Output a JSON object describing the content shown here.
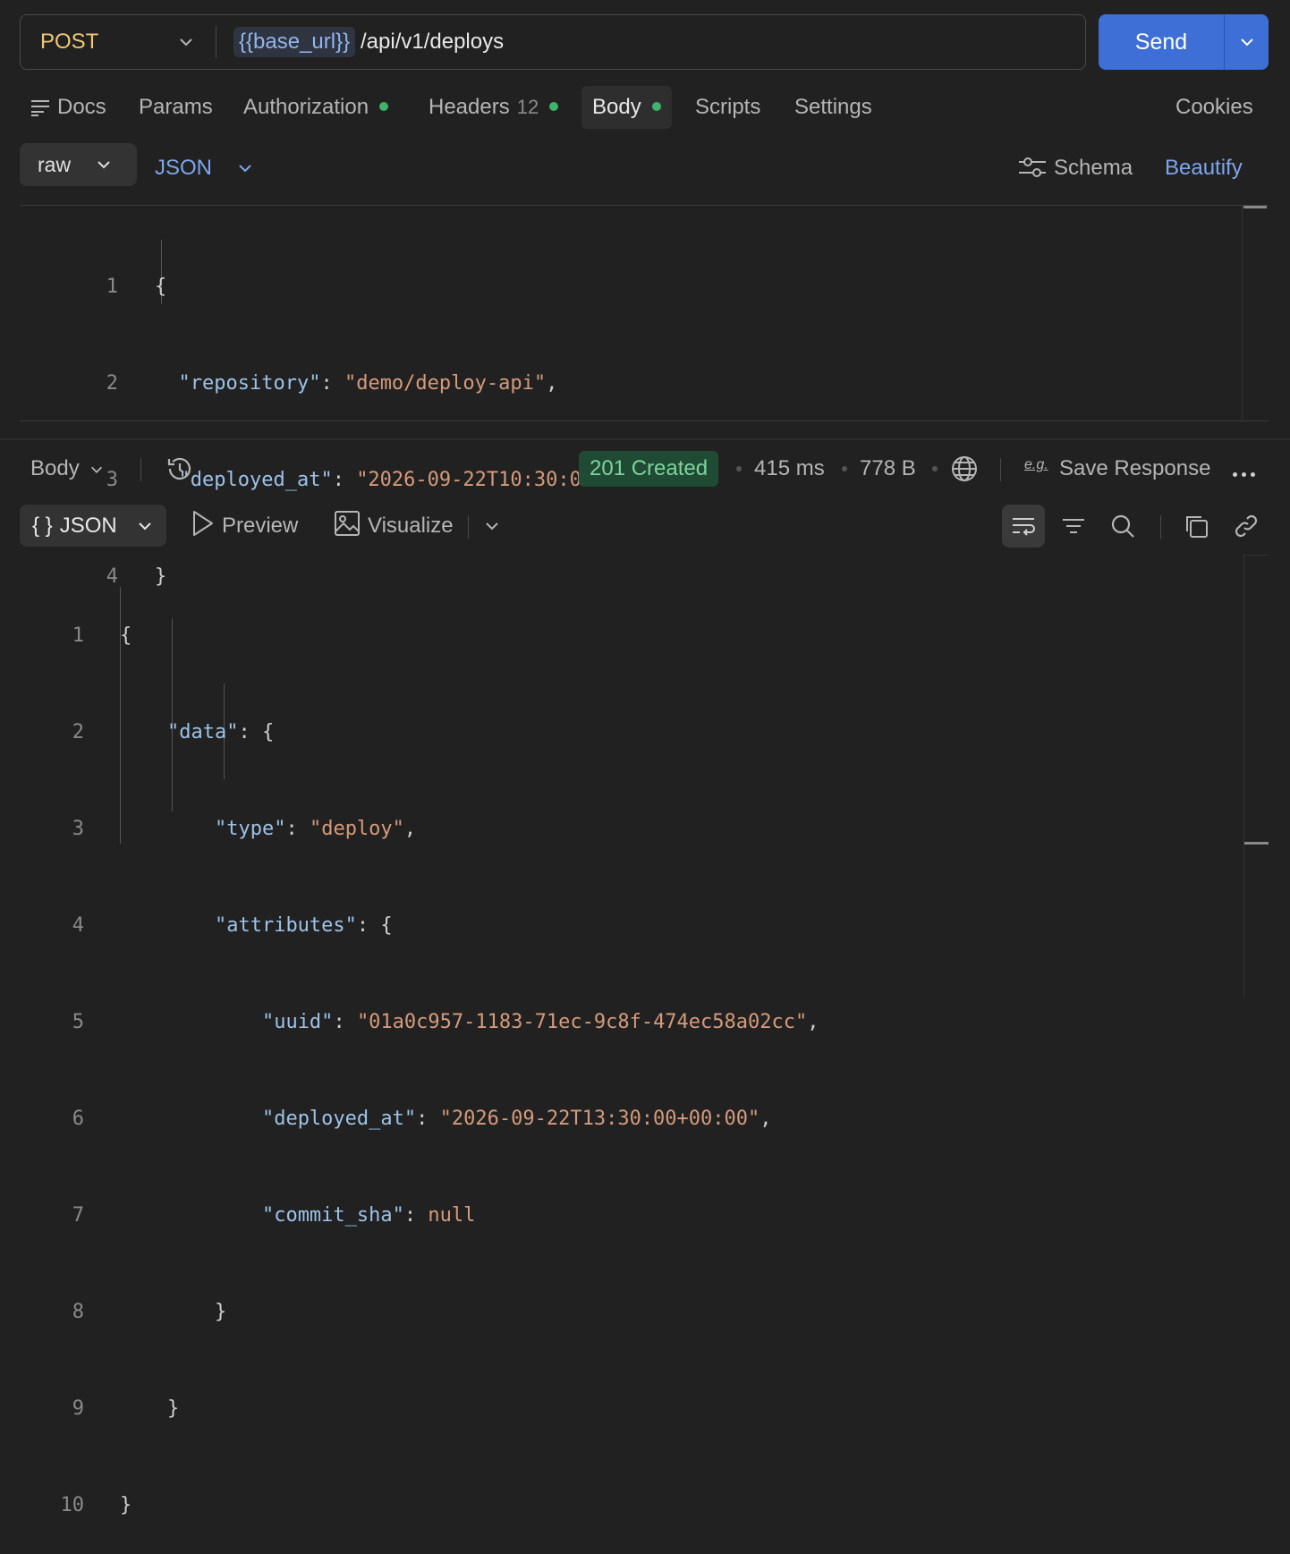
{
  "request": {
    "method": "POST",
    "url_variable": "{{base_url}}",
    "url_path": "/api/v1/deploys",
    "send_label": "Send"
  },
  "tabs": {
    "docs": "Docs",
    "params": "Params",
    "authorization": "Authorization",
    "headers": "Headers",
    "headers_count": "12",
    "body": "Body",
    "scripts": "Scripts",
    "settings": "Settings",
    "cookies": "Cookies"
  },
  "body_options": {
    "mode": "raw",
    "language": "JSON",
    "schema_label": "Schema",
    "beautify_label": "Beautify"
  },
  "request_body": {
    "line_numbers": [
      "1",
      "2",
      "3",
      "4"
    ],
    "open_brace": "{",
    "close_brace": "}",
    "key1": "\"repository\"",
    "val1": "\"demo/deploy-api\"",
    "key2": "\"deployed_at\"",
    "val2": "\"2026-09-22T10:30:00-03:00\""
  },
  "response": {
    "view_label": "Body",
    "status": "201 Created",
    "time": "415 ms",
    "size": "778 B",
    "eg_label": "e.g.",
    "save_label": "Save Response",
    "format_label": "JSON",
    "format_icon": "{ }",
    "preview_label": "Preview",
    "visualize_label": "Visualize",
    "line_numbers": [
      "1",
      "2",
      "3",
      "4",
      "5",
      "6",
      "7",
      "8",
      "9",
      "10"
    ],
    "k_data": "\"data\"",
    "k_type": "\"type\"",
    "v_type": "\"deploy\"",
    "k_attributes": "\"attributes\"",
    "k_uuid": "\"uuid\"",
    "v_uuid": "\"01a0c957-1183-71ec-9c8f-474ec58a02cc\"",
    "k_deployed_at": "\"deployed_at\"",
    "v_deployed_at": "\"2026-09-22T13:30:00+00:00\"",
    "k_commit_sha": "\"commit_sha\"",
    "v_commit_sha": "null",
    "open_brace": "{",
    "close_brace": "}"
  },
  "colors": {
    "accent": "#3d6fd6",
    "method": "#f0c674",
    "status_bg": "#1f4a33",
    "status_text": "#7fd39d",
    "dot": "#3fb26b"
  },
  "icons": [
    "chevron-down-icon",
    "docs-lines-icon",
    "schema-sliders-icon",
    "history-icon",
    "globe-icon",
    "more-icon",
    "play-icon",
    "image-icon",
    "wrap-icon",
    "filter-icon",
    "search-icon",
    "copy-icon",
    "link-icon"
  ]
}
